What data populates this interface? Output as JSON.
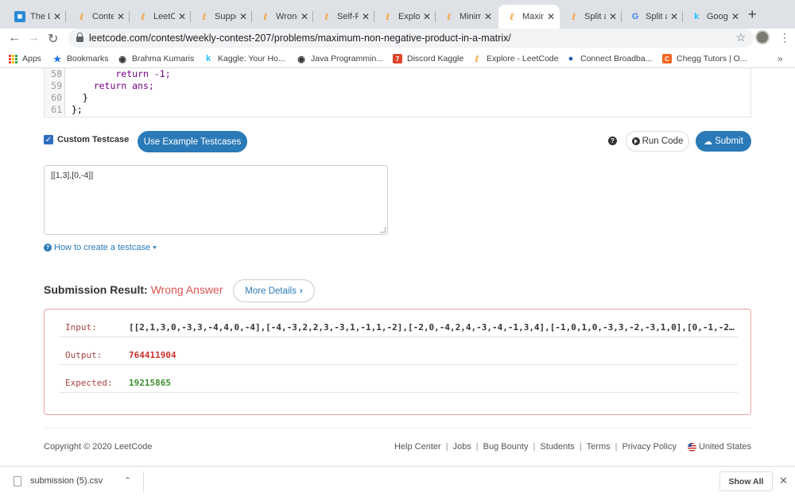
{
  "browser": {
    "tabs": [
      {
        "title": "The L",
        "favicon": "square-icon",
        "active": false
      },
      {
        "title": "Conte",
        "favicon": "leetcode-icon",
        "active": false
      },
      {
        "title": "LeetC",
        "favicon": "leetcode-icon",
        "active": false
      },
      {
        "title": "Suppo",
        "favicon": "leetcode-icon",
        "active": false
      },
      {
        "title": "Wrong",
        "favicon": "leetcode-icon",
        "active": false
      },
      {
        "title": "Self-R",
        "favicon": "leetcode-icon",
        "active": false
      },
      {
        "title": "Explo",
        "favicon": "leetcode-icon",
        "active": false
      },
      {
        "title": "Minim",
        "favicon": "leetcode-icon",
        "active": false
      },
      {
        "title": "Maxin",
        "favicon": "leetcode-icon",
        "active": true
      },
      {
        "title": "Split a",
        "favicon": "leetcode-icon",
        "active": false
      },
      {
        "title": "Split a",
        "favicon": "google-icon",
        "active": false
      },
      {
        "title": "Googl",
        "favicon": "kaggle-icon",
        "active": false
      }
    ],
    "url": "leetcode.com/contest/weekly-contest-207/problems/maximum-non-negative-product-in-a-matrix/",
    "bookmarks": [
      {
        "label": "Apps",
        "icon": "apps-grid-icon"
      },
      {
        "label": "Bookmarks",
        "icon": "star-icon"
      },
      {
        "label": "Brahma Kumaris",
        "icon": "globe-icon"
      },
      {
        "label": "Kaggle: Your Ho...",
        "icon": "kaggle-icon"
      },
      {
        "label": "Java Programmin...",
        "icon": "globe-icon"
      },
      {
        "label": "Discord Kaggle",
        "icon": "discord-icon"
      },
      {
        "label": "Explore - LeetCode",
        "icon": "leetcode-icon"
      },
      {
        "label": "Connect Broadba...",
        "icon": "globe-icon"
      },
      {
        "label": "Chegg Tutors | O...",
        "icon": "chegg-icon"
      }
    ]
  },
  "editor": {
    "lines": [
      {
        "num": "58",
        "code": "        return -1;"
      },
      {
        "num": "59",
        "code": "    return ans;"
      },
      {
        "num": "60",
        "code": "  }"
      },
      {
        "num": "61",
        "code": "};"
      }
    ]
  },
  "testcase": {
    "checkbox_label": "Custom Testcase",
    "checked": true,
    "example_button": "Use Example Testcases",
    "run_button": "Run Code",
    "submit_button": "Submit",
    "input_value": "[[1,3],[0,-4]]",
    "howto_link": "How to create a testcase"
  },
  "result": {
    "heading": "Submission Result:",
    "status": "Wrong Answer",
    "details_button": "More Details",
    "rows": [
      {
        "label": "Input:",
        "value": "[[2,1,3,0,-3,3,-4,4,0,-4],[-4,-3,2,2,3,-3,1,-1,1,-2],[-2,0,-4,2,4,-3,-4,-1,3,4],[-1,0,1,0,-3,3,-2,-3,1,0],[0,-1,-2,..."
      },
      {
        "label": "Output:",
        "value": "764411904"
      },
      {
        "label": "Expected:",
        "value": "19215865"
      }
    ]
  },
  "footer": {
    "copyright": "Copyright © 2020 LeetCode",
    "links": [
      "Help Center",
      "Jobs",
      "Bug Bounty",
      "Students",
      "Terms",
      "Privacy Policy"
    ],
    "region": "United States"
  },
  "downloads": {
    "file": "submission (5).csv",
    "show_all": "Show All"
  },
  "colors": {
    "primary": "#2a7ab8",
    "wrong": "#d9534f",
    "output_red": "#c9302c",
    "expected_green": "#3c8d2f"
  }
}
